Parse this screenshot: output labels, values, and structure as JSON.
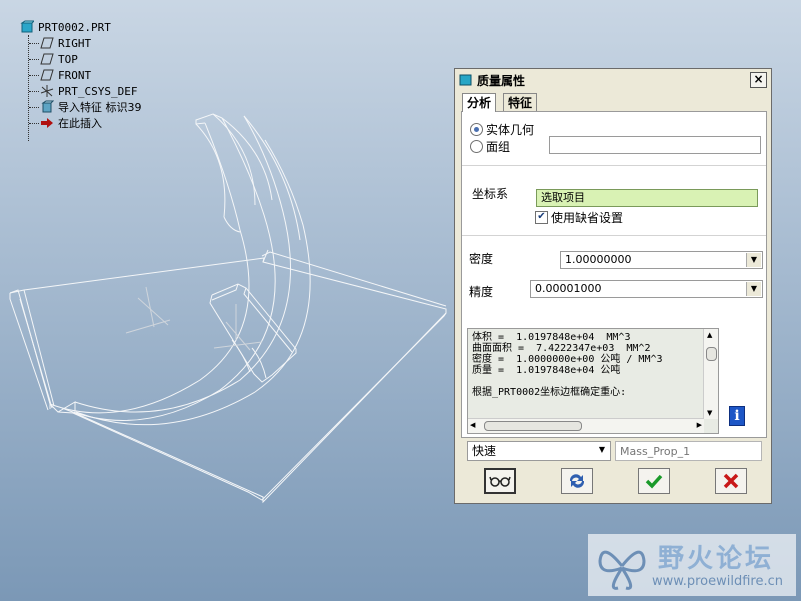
{
  "model_tree": {
    "root": "PRT0002.PRT",
    "items": [
      {
        "label": "RIGHT",
        "icon": "datum-plane-icon"
      },
      {
        "label": "TOP",
        "icon": "datum-plane-icon"
      },
      {
        "label": "FRONT",
        "icon": "datum-plane-icon"
      },
      {
        "label": "PRT_CSYS_DEF",
        "icon": "csys-icon"
      },
      {
        "label": "导入特征 标识39",
        "icon": "import-feature-icon"
      },
      {
        "label": "在此插入",
        "icon": "insert-here-arrow-icon"
      }
    ]
  },
  "dialog": {
    "title": "质量属性",
    "close_label": "×",
    "tabs": [
      "分析",
      "特征"
    ],
    "active_tab": "分析",
    "geometry": {
      "option_solid": "实体几何",
      "option_quilt": "面组",
      "selected": "实体几何",
      "quilt_value": ""
    },
    "csys": {
      "label": "坐标系",
      "selector_text": "选取项目",
      "use_default_label": "使用缺省设置",
      "use_default_checked": true
    },
    "density": {
      "label": "密度",
      "value": "1.00000000"
    },
    "precision": {
      "label": "精度",
      "value": "0.00001000"
    },
    "results_lines": [
      "体积 =  1.0197848e+04  MM^3",
      "曲面面积 =  7.4222347e+03  MM^2",
      "密度 =  1.0000000e+00 公吨 / MM^3",
      "质量 =  1.0197848e+04 公吨",
      "",
      "根据_PRT0002坐标边框确定重心:"
    ],
    "mode": {
      "value": "快速"
    },
    "name_field": {
      "placeholder": "Mass_Prop_1"
    },
    "buttons": {
      "preview": "glasses-preview-icon",
      "repeat": "repeat-refresh-icon",
      "ok": "checkmark-ok-icon",
      "cancel": "cross-cancel-icon"
    },
    "colors": {
      "ok": "#1a9a2a",
      "cancel": "#c81818",
      "selector_bg": "#d9f2b4"
    }
  },
  "watermark": {
    "brand": "野火论坛",
    "url": "www.proewildfire.cn"
  }
}
